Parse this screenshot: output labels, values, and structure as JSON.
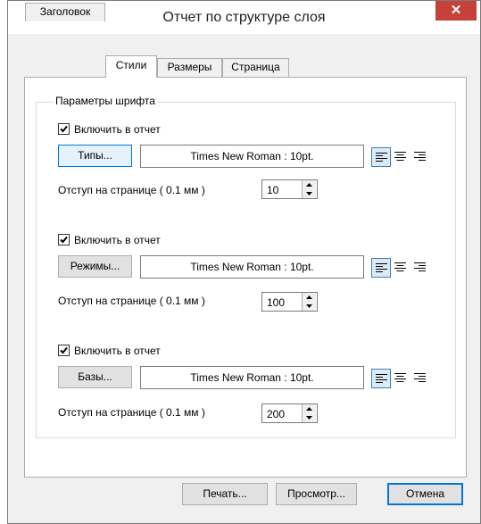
{
  "window": {
    "title": "Отчет по структуре слоя",
    "close_glyph": "✕"
  },
  "tabs": [
    {
      "label": "Заголовок",
      "active": false
    },
    {
      "label": "Стили",
      "active": true
    },
    {
      "label": "Размеры",
      "active": false
    },
    {
      "label": "Страница",
      "active": false
    }
  ],
  "group": {
    "legend": "Параметры шрифта"
  },
  "sections": [
    {
      "include_label": "Включить в отчет",
      "checked": true,
      "font_button": "Типы...",
      "font_value": "Times New Roman : 10pt.",
      "offset_label": "Отступ на странице (  0.1 мм )",
      "offset_value": "10"
    },
    {
      "include_label": "Включить в отчет",
      "checked": true,
      "font_button": "Режимы...",
      "font_value": "Times New Roman : 10pt.",
      "offset_label": "Отступ на странице (  0.1 мм )",
      "offset_value": "100"
    },
    {
      "include_label": "Включить в отчет",
      "checked": true,
      "font_button": "Базы...",
      "font_value": "Times New Roman : 10pt.",
      "offset_label": "Отступ на странице (  0.1 мм )",
      "offset_value": "200"
    }
  ],
  "footer": {
    "print": "Печать...",
    "preview": "Просмотр...",
    "cancel": "Отмена"
  },
  "icons": {
    "align_left": "align-left-icon",
    "align_center": "align-center-icon",
    "align_right": "align-right-icon",
    "checkmark": "checkmark-icon"
  },
  "colors": {
    "accent": "#0078d7",
    "close": "#c7403a"
  }
}
